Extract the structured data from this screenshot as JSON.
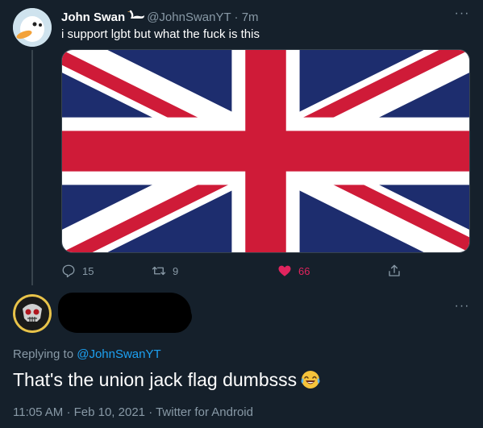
{
  "tweet": {
    "author_name": "John Swan",
    "author_handle": "@JohnSwanYT",
    "separator": "·",
    "time_ago": "7m",
    "text": "i support lgbt but what the fuck is this",
    "media": {
      "description_icon": "union-jack-flag"
    },
    "actions": {
      "replies": "15",
      "retweets": "9",
      "likes": "66"
    },
    "more_icon": "···"
  },
  "reply": {
    "replying_label": "Replying to",
    "mention": "@JohnSwanYT",
    "text": "That's the union jack flag dumbsss",
    "emoji": "face-with-tears-of-joy",
    "time": "11:05 AM",
    "separator": "·",
    "date": "Feb 10, 2021",
    "app": "Twitter for Android",
    "more_icon": "···"
  },
  "colors": {
    "background": "#15202b",
    "secondary_text": "#8899a6",
    "link": "#1da1f2",
    "like": "#e0245e",
    "flag_blue": "#1d2d6e",
    "flag_red": "#cf1b38"
  }
}
